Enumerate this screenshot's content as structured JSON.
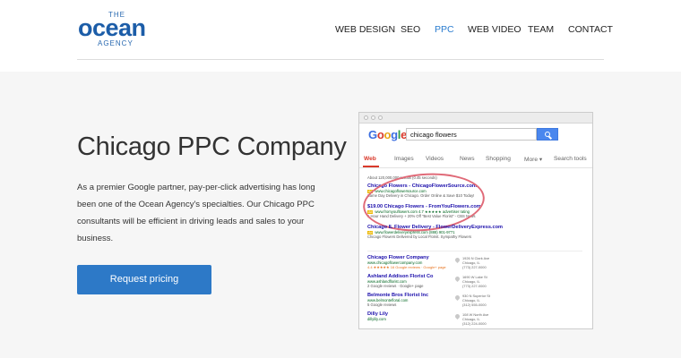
{
  "brand": {
    "logo_top": "THE",
    "logo_main": "ocean",
    "logo_bottom": "AGENCY",
    "color": "#1c5da8"
  },
  "nav": {
    "items": [
      {
        "label": "WEB DESIGN",
        "active": false
      },
      {
        "label": "SEO",
        "active": false
      },
      {
        "label": "PPC",
        "active": true
      },
      {
        "label": "WEB VIDEO",
        "active": false
      },
      {
        "label": "TEAM",
        "active": false
      },
      {
        "label": "CONTACT",
        "active": false
      }
    ],
    "active_color": "#2a7ccf"
  },
  "hero": {
    "title": "Chicago PPC Company",
    "body": "As a premier Google partner, pay-per-click advertising has long been one of the Ocean Agency's specialties. Our Chicago PPC consultants will be efficient in driving leads and sales to your business.",
    "cta_label": "Request pricing",
    "cta_color": "#2d79c7"
  },
  "mockup": {
    "logo": [
      "G",
      "o",
      "o",
      "g",
      "l",
      "e"
    ],
    "query": "chicago flowers",
    "tabs": [
      "Web",
      "Images",
      "Videos",
      "News",
      "Shopping",
      "More ▾",
      "Search tools"
    ],
    "results_count": "About 120,000,000 results (0.45 seconds)",
    "ads": [
      {
        "title": "Chicago Flowers - ChicagoFlowerSource.com",
        "url": "www.chicagoflowersource.com",
        "desc": "Same Day Delivery in Chicago. Order Online & Save $10 Today!"
      },
      {
        "title": "$19.00 Chicago Flowers - FromYouFlowers.com",
        "url": "www.fromyouflowers.com  4.7 ★★★★★ advertiser rating",
        "desc": "1 Hour Hand Delivery + 20% Off \"Best Value Florist\" - CBS News"
      },
      {
        "title": "Chicago IL Flower Delivery - FlowerDeliveryExpress.com",
        "url": "www.flowerdeliveryexpress.com  (888) 901-9771",
        "desc": "Chicago Flowers Delivered by Local Florist. Sympathy Flowers"
      }
    ],
    "local": [
      {
        "title": "Chicago Flower Company",
        "url": "www.chicagoflowercompany.com",
        "meta": "4.4 ★★★★★ 16 Google reviews · Google+ page",
        "addr": "1926 N Clark Ave\nChicago, IL\n(773) 227-0000"
      },
      {
        "title": "Ashland Addison Florist Co",
        "url": "www.ashlandflorist.com",
        "meta": "2 Google reviews · Google+ page",
        "addr": "1690 W Lake St\nChicago, IL\n(773) 227-0000"
      },
      {
        "title": "Belmonte Bros Florist Inc",
        "url": "www.belmontefloral.com",
        "meta": "5 Google reviews",
        "addr": "930 N Superior St\nChicago, IL\n(312) 555-0000"
      },
      {
        "title": "Dilly Lily",
        "url": "dillylily.com",
        "meta": "",
        "addr": "108 W North Ave\nChicago, IL\n(312) 224-0000"
      }
    ]
  }
}
